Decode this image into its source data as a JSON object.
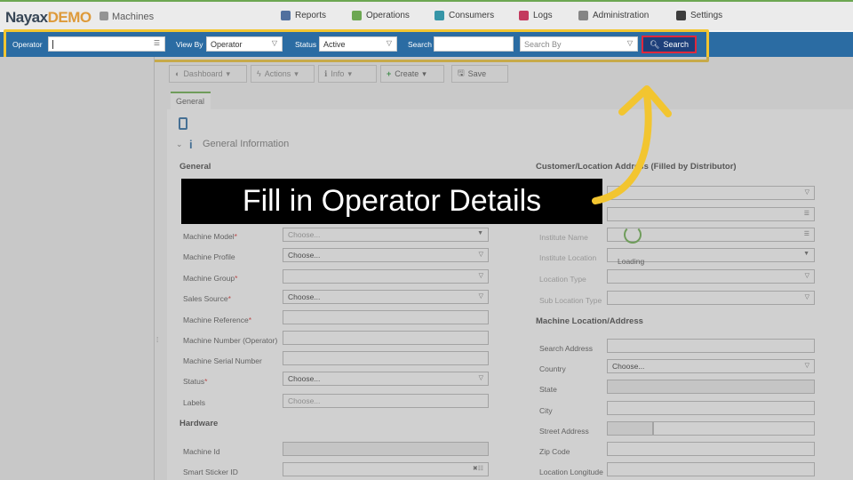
{
  "brand": {
    "part1": "Nayax",
    "part2": "DEMO"
  },
  "breadcrumb": "Machines",
  "nav": [
    "Reports",
    "Operations",
    "Consumers",
    "Logs",
    "Administration",
    "Settings"
  ],
  "filter": {
    "operator_label": "Operator",
    "operator_value": "",
    "viewby_label": "View By",
    "viewby_value": "Operator",
    "status_label": "Status",
    "status_value": "Active",
    "search_label": "Search",
    "search_value": "",
    "searchby_placeholder": "Search By",
    "search_button": "Search"
  },
  "toolbar": {
    "dashboard": "Dashboard",
    "actions": "Actions",
    "info": "Info",
    "create": "Create",
    "save": "Save"
  },
  "tab": "General",
  "section": "General Information",
  "left": {
    "heading": "General",
    "fields": [
      {
        "label": "Machine Model",
        "required": "*",
        "value": "Choose..."
      },
      {
        "label": "Machine Profile",
        "required": "",
        "value": "Choose..."
      },
      {
        "label": "Machine Group",
        "required": "*",
        "value": ""
      },
      {
        "label": "Sales Source",
        "required": "*",
        "value": "Choose..."
      },
      {
        "label": "Machine Reference",
        "required": "*",
        "value": ""
      },
      {
        "label": "Machine Number (Operator)",
        "required": "",
        "value": ""
      },
      {
        "label": "Machine Serial Number",
        "required": "",
        "value": ""
      },
      {
        "label": "Status",
        "required": "*",
        "value": "Choose..."
      },
      {
        "label": "Labels",
        "required": "",
        "value": "Choose..."
      }
    ],
    "hardware_heading": "Hardware",
    "hardware_fields": [
      {
        "label": "Machine Id",
        "value": ""
      },
      {
        "label": "Smart Sticker ID",
        "value": ""
      }
    ]
  },
  "right": {
    "heading": "Customer/Location Address (Filled by Distributor)",
    "fields": [
      {
        "label": "Institute Name"
      },
      {
        "label": "Institute Location"
      },
      {
        "label": "Location Type"
      },
      {
        "label": "Sub Location Type"
      }
    ],
    "loading": "Loading",
    "location_heading": "Machine Location/Address",
    "location_fields": [
      {
        "label": "Search Address",
        "value": ""
      },
      {
        "label": "Country",
        "value": "Choose..."
      },
      {
        "label": "State",
        "value": ""
      },
      {
        "label": "City",
        "value": ""
      },
      {
        "label": "Street Address",
        "value": ""
      },
      {
        "label": "Zip Code",
        "value": ""
      },
      {
        "label": "Location Longitude",
        "value": ""
      }
    ]
  },
  "banner": "Fill in Operator Details",
  "colors": {
    "accent": "#f2c530",
    "filterbar": "#2b6ca3",
    "search_btn": "#1d3f7a",
    "highlight_red": "#e0283c",
    "green": "#6ab04c"
  }
}
